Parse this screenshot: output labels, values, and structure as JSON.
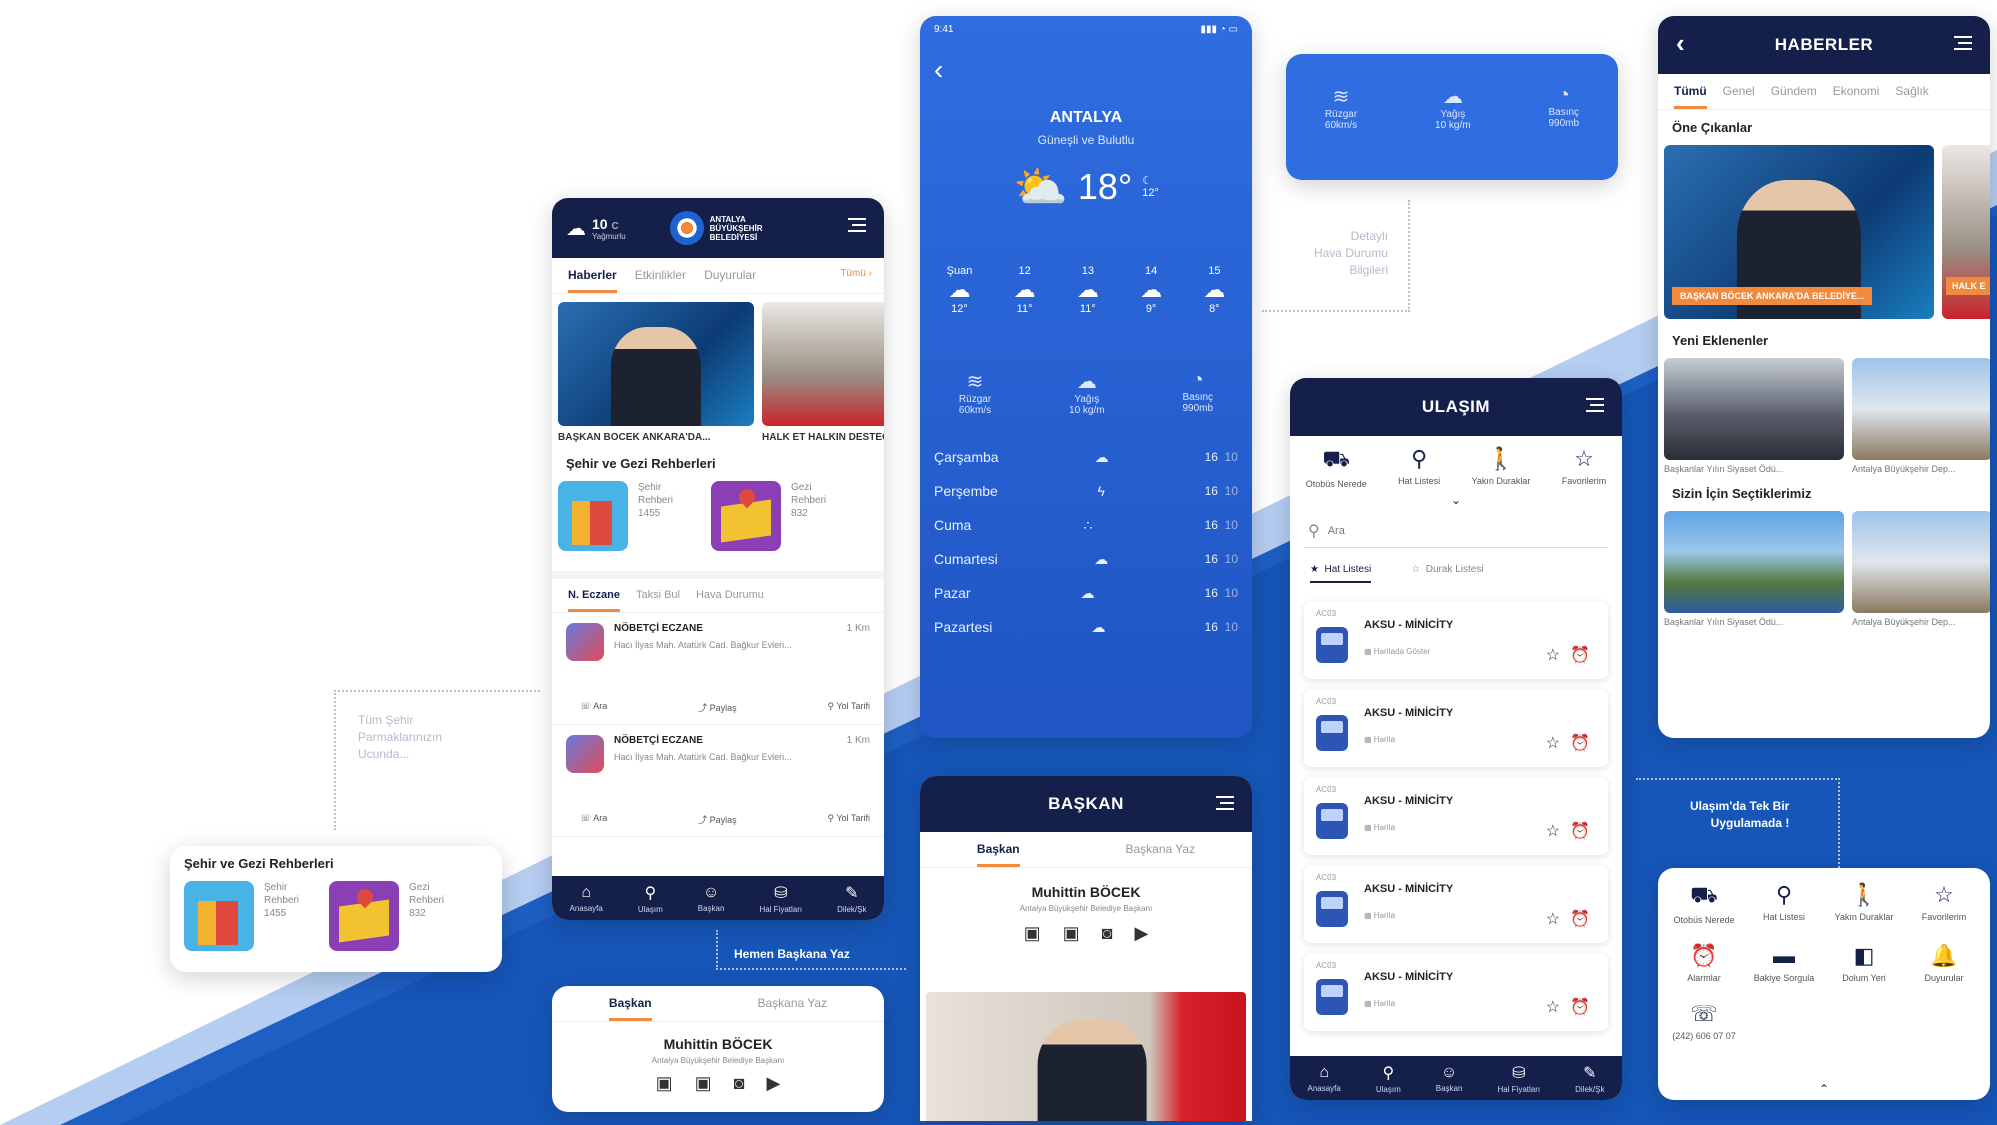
{
  "colors": {
    "navy": "#15204a",
    "blue": "#1f63d1",
    "accent": "#f08a3c"
  },
  "home": {
    "weather_temp": "10",
    "weather_unit": "C",
    "weather_desc": "Yağmurlu",
    "logo_line1": "ANTALYA",
    "logo_line2": "BÜYÜKŞEHİR",
    "logo_line3": "BELEDİYESİ",
    "tabs": [
      "Haberler",
      "Etkinlikler",
      "Duyurular"
    ],
    "tabs_all": "Tümü ›",
    "news_captions": [
      "BAŞKAN BÖCEK ANKARA'DA...",
      "HALK ET HALKIN DESTEĞ"
    ],
    "guides_title": "Şehir ve Gezi Rehberleri",
    "guides": [
      {
        "l1": "Şehir",
        "l2": "Rehberi",
        "c": "1455"
      },
      {
        "l1": "Gezi",
        "l2": "Rehberi",
        "c": "832"
      }
    ],
    "info_tabs": [
      "N. Eczane",
      "Taksi Bul",
      "Hava Durumu"
    ],
    "pharmacies": [
      {
        "title": "NÖBETÇİ ECZANE",
        "dist": "1 Km",
        "addr": "Hacı İlyas Mah. Atatürk Cad. Bağkur Evleri..."
      },
      {
        "title": "NÖBETÇİ ECZANE",
        "dist": "1 Km",
        "addr": "Hacı İlyas Mah. Atatürk Cad. Bağkur Evleri..."
      }
    ],
    "actions": [
      "Ara",
      "Paylaş",
      "Yol Tarifi"
    ],
    "nav": [
      "Anasayfa",
      "Ulaşım",
      "Başkan",
      "Hal Fiyatları",
      "Dilek/Şk"
    ]
  },
  "guides_card": {
    "title": "Şehir ve Gezi Rehberleri",
    "items": [
      {
        "l1": "Şehir",
        "l2": "Rehberi",
        "c": "1455"
      },
      {
        "l1": "Gezi",
        "l2": "Rehberi",
        "c": "832"
      }
    ]
  },
  "notes": {
    "fingertip": [
      "Tüm Şehir",
      "Parmaklarınızın",
      "Ucunda..."
    ],
    "mayor": "Hemen Başkana Yaz",
    "weather": [
      "Detaylı",
      "Hava Durumu",
      "Bilgileri"
    ],
    "transport": [
      "Ulaşım'da Tek Bir",
      "Uygulamada !"
    ]
  },
  "mayor_small": {
    "tabs": [
      "Başkan",
      "Başkana Yaz"
    ],
    "name": "Muhittin BÖCEK",
    "role": "Antalya Büyükşehir Belediye Başkanı"
  },
  "weather": {
    "time": "9:41",
    "city": "ANTALYA",
    "desc": "Güneşli ve Bulutlu",
    "temp": "18°",
    "low": "12°",
    "hours": [
      {
        "h": "Şuan",
        "t": "12°"
      },
      {
        "h": "12",
        "t": "11°"
      },
      {
        "h": "13",
        "t": "11°"
      },
      {
        "h": "14",
        "t": "9°"
      },
      {
        "h": "15",
        "t": "8°"
      }
    ],
    "stats": [
      {
        "l": "Rüzgar",
        "v": "60km/s"
      },
      {
        "l": "Yağış",
        "v": "10 kg/m"
      },
      {
        "l": "Basınç",
        "v": "990mb"
      }
    ],
    "days": [
      {
        "d": "Çarşamba",
        "hi": "16",
        "lo": "10"
      },
      {
        "d": "Perşembe",
        "hi": "16",
        "lo": "10"
      },
      {
        "d": "Cuma",
        "hi": "16",
        "lo": "10"
      },
      {
        "d": "Cumartesi",
        "hi": "16",
        "lo": "10"
      },
      {
        "d": "Pazar",
        "hi": "16",
        "lo": "10"
      },
      {
        "d": "Pazartesi",
        "hi": "16",
        "lo": "10"
      }
    ]
  },
  "stat_card": [
    {
      "l": "Rüzgar",
      "v": "60km/s"
    },
    {
      "l": "Yağış",
      "v": "10 kg/m"
    },
    {
      "l": "Basınç",
      "v": "990mb"
    }
  ],
  "mayor": {
    "title": "BAŞKAN",
    "tabs": [
      "Başkan",
      "Başkana Yaz"
    ],
    "name": "Muhittin BÖCEK",
    "role": "Antalya Büyükşehir Belediye Başkanı"
  },
  "transport": {
    "title": "ULAŞIM",
    "icons": [
      "Otobüs Nerede",
      "Hat Listesi",
      "Yakın Duraklar",
      "Favorilerim"
    ],
    "search_placeholder": "Ara",
    "sub_tabs": [
      "Hat Listesi",
      "Durak Listesi"
    ],
    "lines": [
      {
        "code": "AC03",
        "name": "AKSU - MİNİCİTY",
        "sub": "Haritada Göster"
      },
      {
        "code": "AC03",
        "name": "AKSU - MİNİCİTY",
        "sub": "Harita"
      },
      {
        "code": "AC03",
        "name": "AKSU - MİNİCİTY",
        "sub": "Harita"
      },
      {
        "code": "AC03",
        "name": "AKSU - MİNİCİTY",
        "sub": "Harita"
      },
      {
        "code": "AC03",
        "name": "AKSU - MİNİCİTY",
        "sub": "Harita"
      }
    ],
    "nav": [
      "Anasayfa",
      "Ulaşım",
      "Başkan",
      "Hal Fiyatları",
      "Dilek/Şk"
    ]
  },
  "news": {
    "title": "HABERLER",
    "tabs": [
      "Tümü",
      "Genel",
      "Gündem",
      "Ekonomi",
      "Sağlık"
    ],
    "featured_title": "Öne Çıkanlar",
    "featured_caption": "BAŞKAN BÖCEK ANKARA'DA BELEDİYE...",
    "featured_caption2": "HALK E",
    "recent_title": "Yeni Eklenenler",
    "recent": [
      "Başkanlar Yılın Siyaset Ödü...",
      "Antalya Büyükşehir Dep..."
    ],
    "picks_title": "Sizin İçin Seçtiklerimiz",
    "picks": [
      "Başkanlar Yılın Siyaset Ödü...",
      "Antalya Büyükşehir Dep..."
    ]
  },
  "menu": {
    "items": [
      "Otobüs Nerede",
      "Hat Listesi",
      "Yakın Duraklar",
      "Favorilerim",
      "Alarmlar",
      "Bakiye Sorgula",
      "Dolum Yeri",
      "Duyurular"
    ],
    "phone": "(242) 606 07 07"
  }
}
